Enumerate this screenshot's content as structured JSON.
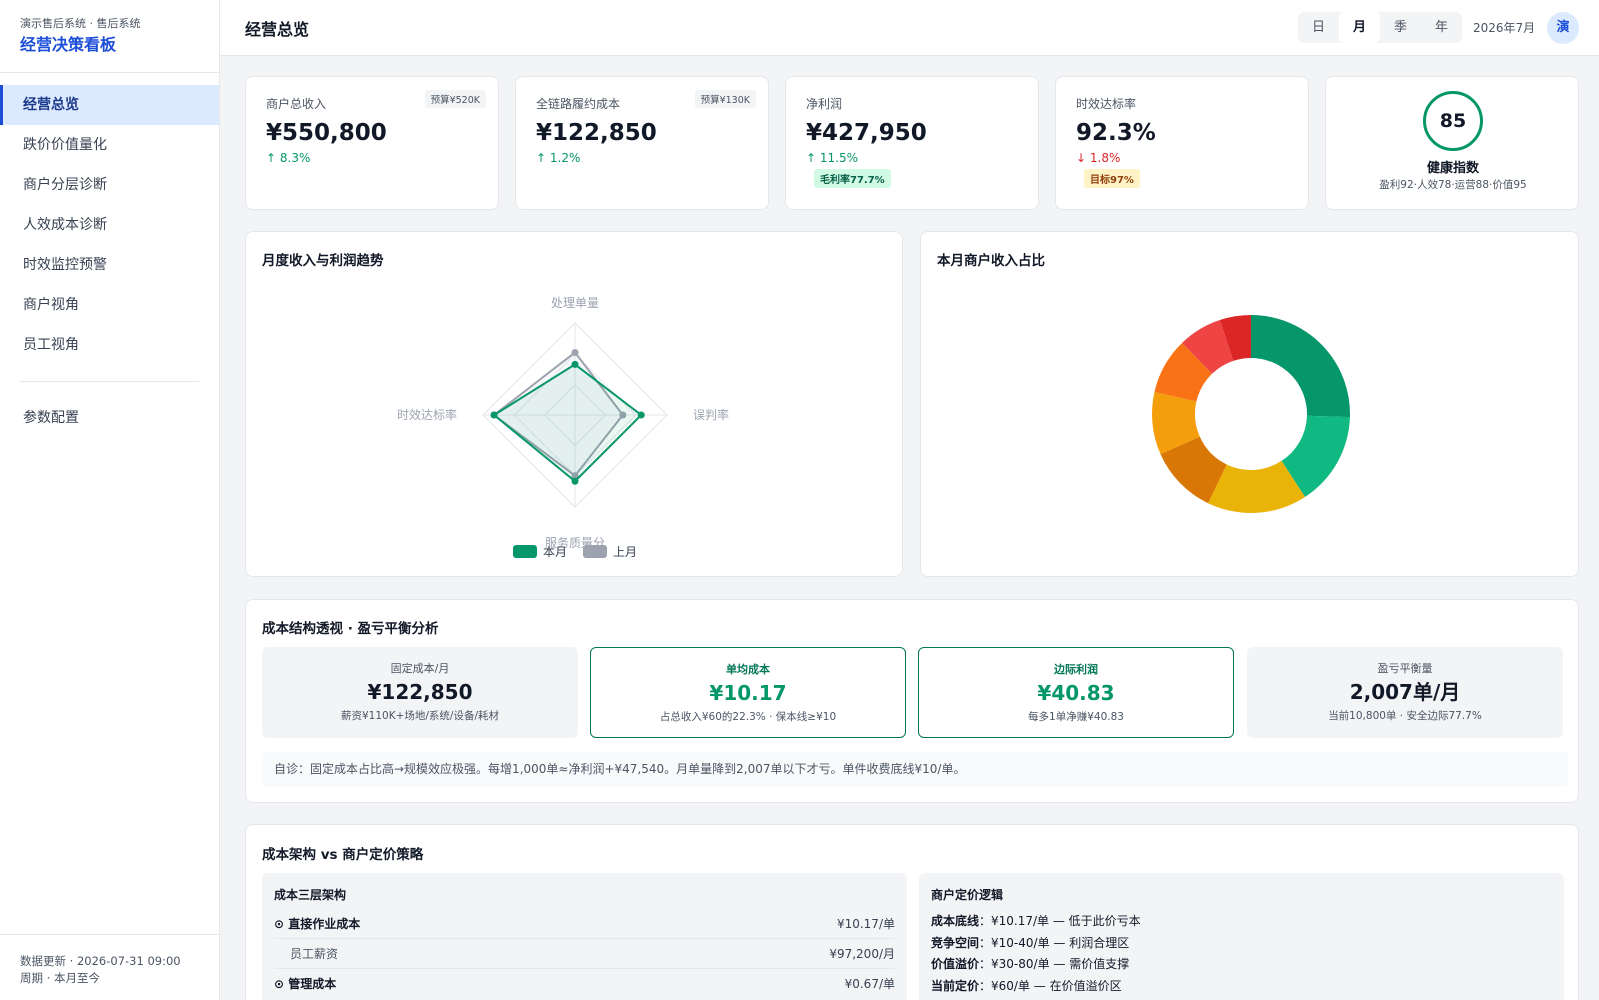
{
  "brand": {
    "subtitle": "演示售后系统 · 售后系统",
    "title": "经营决策看板"
  },
  "nav": {
    "items": [
      {
        "label": "经营总览",
        "active": true
      },
      {
        "label": "跌价价值量化"
      },
      {
        "label": "商户分层诊断"
      },
      {
        "label": "人效成本诊断"
      },
      {
        "label": "时效监控预警"
      },
      {
        "label": "商户视角"
      },
      {
        "label": "员工视角"
      }
    ],
    "settings_label": "参数配置"
  },
  "footer": {
    "line1": "数据更新 · 2026-07-31 09:00",
    "line2": "周期 · 本月至今"
  },
  "header": {
    "title": "经营总览",
    "periods": [
      "日",
      "月",
      "季",
      "年"
    ],
    "active_period": "月",
    "date": "2026年7月",
    "avatar": "演"
  },
  "kpis": [
    {
      "label": "商户总收入",
      "badge": "预算¥520K",
      "value": "¥550,800",
      "trend": "↑ 8.3%",
      "trend_dir": "up"
    },
    {
      "label": "全链路履约成本",
      "badge": "预算¥130K",
      "value": "¥122,850",
      "trend": "↑ 1.2%",
      "trend_dir": "up"
    },
    {
      "label": "净利润",
      "value": "¥427,950",
      "trend": "↑ 11.5%",
      "trend_dir": "up",
      "tag": "毛利率77.7%"
    },
    {
      "label": "时效达标率",
      "value": "92.3%",
      "trend": "↓ 1.8%",
      "trend_dir": "down",
      "tag": "目标97%"
    }
  ],
  "health": {
    "score": "85",
    "title": "健康指数",
    "sub": "盈利92·人效78·运营88·价值95"
  },
  "trend_section": {
    "title": "月度收入与利润趋势"
  },
  "share_section": {
    "title": "本月商户收入占比"
  },
  "chart_data": [
    {
      "type": "radar",
      "axes": [
        "处理单量",
        "误判率",
        "服务质量分",
        "时效达标率"
      ],
      "series": [
        {
          "name": "本月",
          "color": "#059669",
          "values": [
            0.55,
            0.72,
            0.72,
            0.88
          ]
        },
        {
          "name": "上月",
          "color": "#9ca3af",
          "values": [
            0.68,
            0.52,
            0.66,
            0.88
          ]
        }
      ],
      "legend": "bottom"
    },
    {
      "type": "pie",
      "donut": true,
      "slices": [
        {
          "value": 25,
          "color": "#059669"
        },
        {
          "value": 15,
          "color": "#10b981"
        },
        {
          "value": 16,
          "color": "#eab308"
        },
        {
          "value": 11,
          "color": "#d97706"
        },
        {
          "value": 10,
          "color": "#f59e0b"
        },
        {
          "value": 9,
          "color": "#f97316"
        },
        {
          "value": 7,
          "color": "#ef4444"
        },
        {
          "value": 5,
          "color": "#dc2626"
        }
      ]
    }
  ],
  "breakeven": {
    "title": "成本结构透视 · 盈亏平衡分析",
    "boxes": [
      {
        "label": "固定成本/月",
        "value": "¥122,850",
        "sub": "薪资¥110K+场地/系统/设备/耗材",
        "accent": false
      },
      {
        "label": "单均成本",
        "value": "¥10.17",
        "sub": "占总收入¥60的22.3% · 保本线≥¥10",
        "accent": true
      },
      {
        "label": "边际利润",
        "value": "¥40.83",
        "sub": "每多1单净赚¥40.83",
        "accent": true
      },
      {
        "label": "盈亏平衡量",
        "value": "2,007单/月",
        "sub": "当前10,800单 · 安全边际77.7%",
        "accent": false
      }
    ],
    "diagnosis": "自诊：固定成本占比高→规模效应极强。每增1,000单≈净利润+¥47,540。月单量降到2,007单以下才亏。单件收费底线¥10/单。"
  },
  "pricing": {
    "title": "成本架构 vs 商户定价策略",
    "cost_panel": {
      "title": "成本三层架构",
      "rows": [
        {
          "label": "⊙ 直接作业成本",
          "value": "¥10.17/单",
          "level": "main"
        },
        {
          "label": "员工薪资",
          "value": "¥97,200/月",
          "level": "sub"
        },
        {
          "label": "⊙ 管理成本",
          "value": "¥0.67/单",
          "level": "main"
        }
      ]
    },
    "logic_panel": {
      "title": "商户定价逻辑",
      "lines": [
        {
          "key": "成本底线",
          "text": "：¥10.17/单 — 低于此价亏本"
        },
        {
          "key": "竞争空间",
          "text": "：¥10-40/单 — 利润合理区"
        },
        {
          "key": "价值溢价",
          "text": "：¥30-80/单 — 需价值支撑"
        },
        {
          "key": "当前定价",
          "text": "：¥60/单 — 在价值溢价区"
        }
      ]
    }
  }
}
